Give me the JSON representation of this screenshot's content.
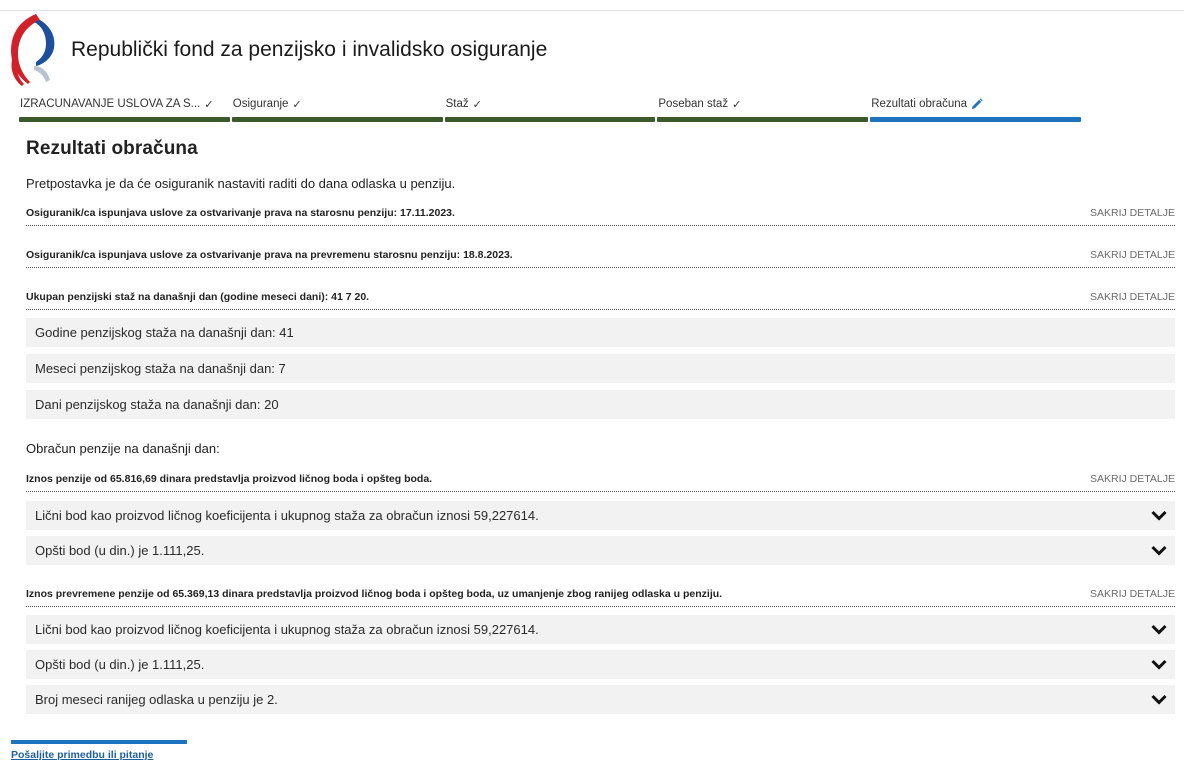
{
  "header": {
    "site_title": "Republički fond za penzijsko i invalidsko osiguranje"
  },
  "steps": [
    {
      "label": "IZRAČUNAVANJE USLOVA ZA S...",
      "status": "done"
    },
    {
      "label": "Osiguranje",
      "status": "done"
    },
    {
      "label": "Staž",
      "status": "done"
    },
    {
      "label": "Poseban staž",
      "status": "done"
    },
    {
      "label": "Rezultati obračuna",
      "status": "active"
    }
  ],
  "colors": {
    "step_done": "#3a5a2a",
    "step_active": "#1e73be",
    "row_bg": "#f2f2f2",
    "logo_red": "#d0202a",
    "logo_blue": "#1e4f9c"
  },
  "main": {
    "title": "Rezultati obračuna",
    "assumption": "Pretpostavka je da će osiguranik nastaviti raditi do dana odlaska u penziju.",
    "toggle_label": "SAKRIJ DETALJE",
    "sections": {
      "old_age": "Osiguranik/ca ispunjava uslove za ostvarivanje prava na starosnu penziju: 17.11.2023.",
      "early": "Osiguranik/ca ispunjava uslove za ostvarivanje prava na prevremenu starosnu penziju: 18.8.2023.",
      "total_service": "Ukupan penzijski staž na današnji dan (godine meseci dani): 41 7 20."
    },
    "service_rows": [
      "Godine penzijskog staža na današnji dan: 41",
      "Meseci penzijskog staža na današnji dan: 7",
      "Dani penzijskog staža na današnji dan: 20"
    ],
    "calc_label": "Obračun penzije na današnji dan:",
    "pension": {
      "summary": "Iznos penzije od 65.816,69 dinara predstavlja proizvod ličnog boda i opšteg boda.",
      "rows": [
        "Lični bod kao proizvod ličnog koeficijenta i ukupnog staža za obračun iznosi 59,227614.",
        "Opšti bod (u din.) je 1.111,25."
      ]
    },
    "early_pension": {
      "summary": "Iznos prevremene penzije od 65.369,13 dinara predstavlja proizvod ličnog boda i opšteg boda, uz umanjenje zbog ranijeg odlaska u penziju.",
      "rows": [
        "Lični bod kao proizvod ličnog koeficijenta i ukupnog staža za obračun iznosi 59,227614.",
        "Opšti bod (u din.) je 1.111,25.",
        "Broj meseci ranijeg odlaska u penziju je 2."
      ]
    }
  },
  "footer": {
    "link": "Pošaljite primedbu ili pitanje"
  }
}
